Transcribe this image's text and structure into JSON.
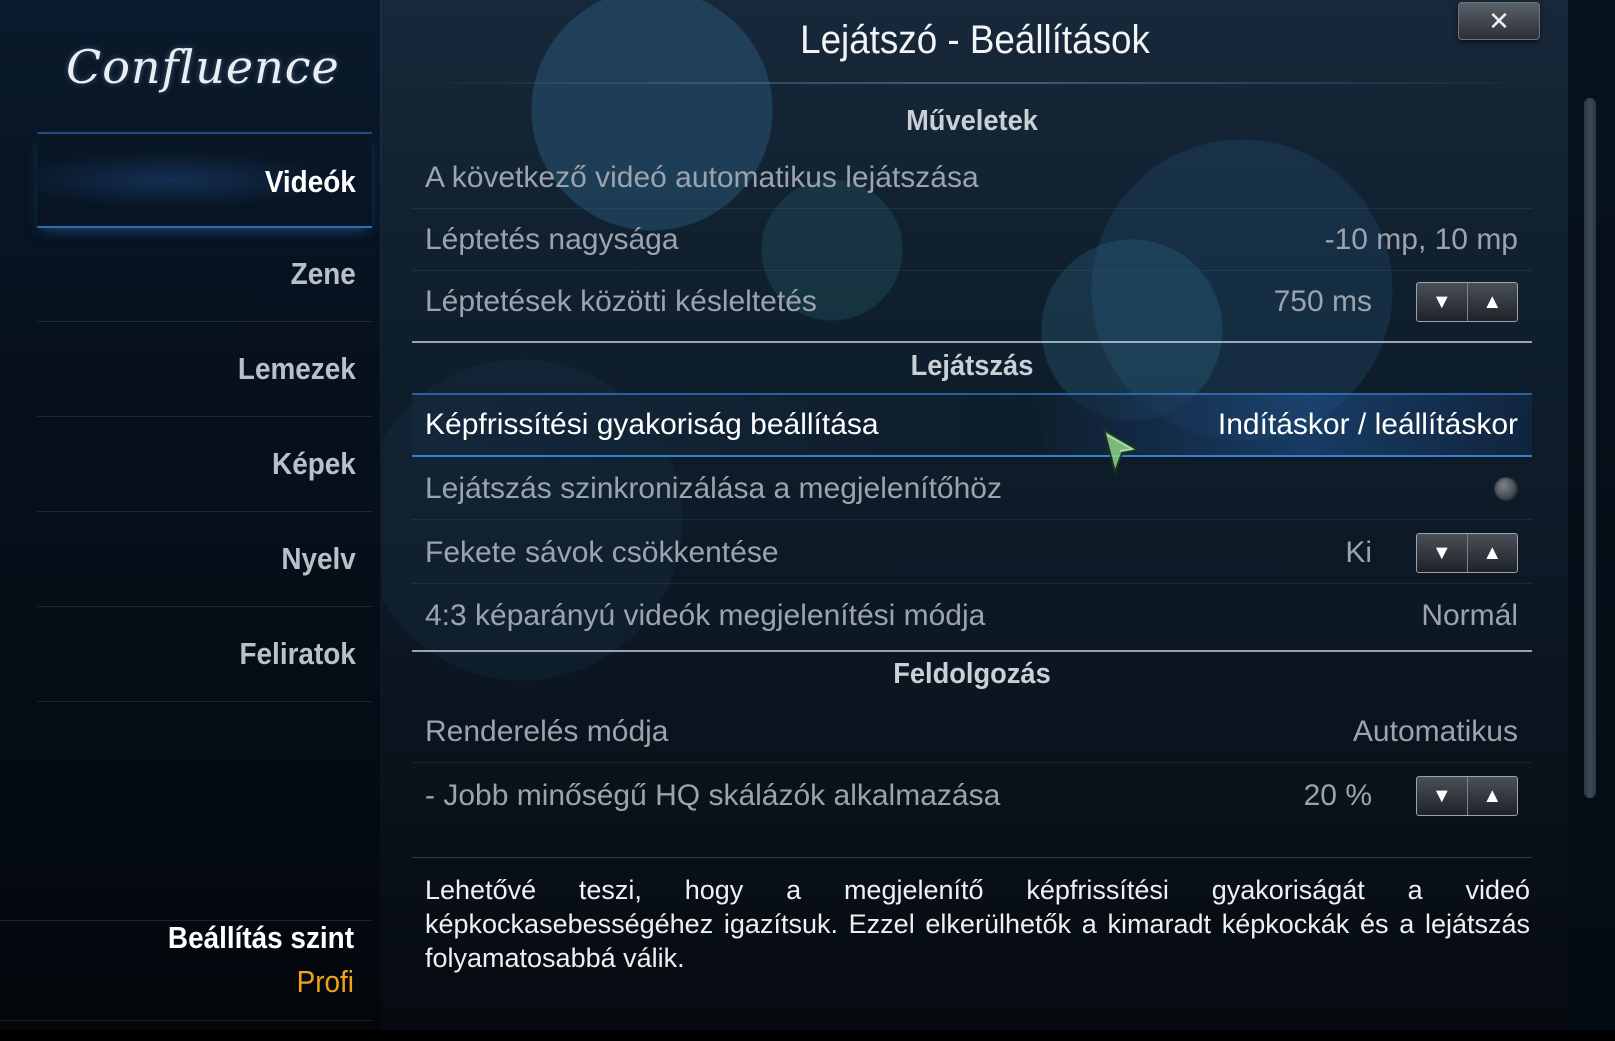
{
  "app": {
    "logo_text": "Confluence",
    "window_title": "Lejátszó - Beállítások",
    "close_label": "✕"
  },
  "sidebar": {
    "items": [
      {
        "label": "Videók",
        "active": true
      },
      {
        "label": "Zene",
        "active": false
      },
      {
        "label": "Lemezek",
        "active": false
      },
      {
        "label": "Képek",
        "active": false
      },
      {
        "label": "Nyelv",
        "active": false
      },
      {
        "label": "Feliratok",
        "active": false
      }
    ],
    "level_label": "Beállítás szint",
    "level_value": "Profi"
  },
  "sections": [
    {
      "title": "Műveletek",
      "rows": [
        {
          "label": "A következő videó automatikus lejátszása",
          "value": ""
        },
        {
          "label": "Léptetés nagysága",
          "value": "-10 mp, 10 mp"
        },
        {
          "label": "Léptetések közötti késleltetés",
          "value": "750 ms"
        }
      ]
    },
    {
      "title": "Lejátszás",
      "rows": [
        {
          "label": "Képfrissítési gyakoriság beállítása",
          "value": "Indításkor / leállításkor"
        },
        {
          "label": "Lejátszás szinkronizálása a megjelenítőhöz",
          "value": ""
        },
        {
          "label": "Fekete sávok csökkentése",
          "value": "Ki"
        },
        {
          "label": "4:3 képarányú videók megjelenítési módja",
          "value": "Normál"
        }
      ]
    },
    {
      "title": "Feldolgozás",
      "rows": [
        {
          "label": "Renderelés módja",
          "value": "Automatikus"
        },
        {
          "label": "- Jobb minőségű HQ skálázók alkalmazása",
          "value": "20 %"
        }
      ]
    }
  ],
  "spinner": {
    "down_glyph": "▼",
    "up_glyph": "▲"
  },
  "description": "Lehetővé teszi, hogy a megjelenítő képfrissítési gyakoriságát a videó képkockasebességéhez igazítsuk. Ezzel elkerülhetők a kimaradt képkockák és a lejátszás folyamatosabbá válik.",
  "colors": {
    "accent": "#2b6fb3",
    "level_value": "#f0a21a",
    "text_dim": "#9ba4ad",
    "text_bright": "#ffffff"
  }
}
